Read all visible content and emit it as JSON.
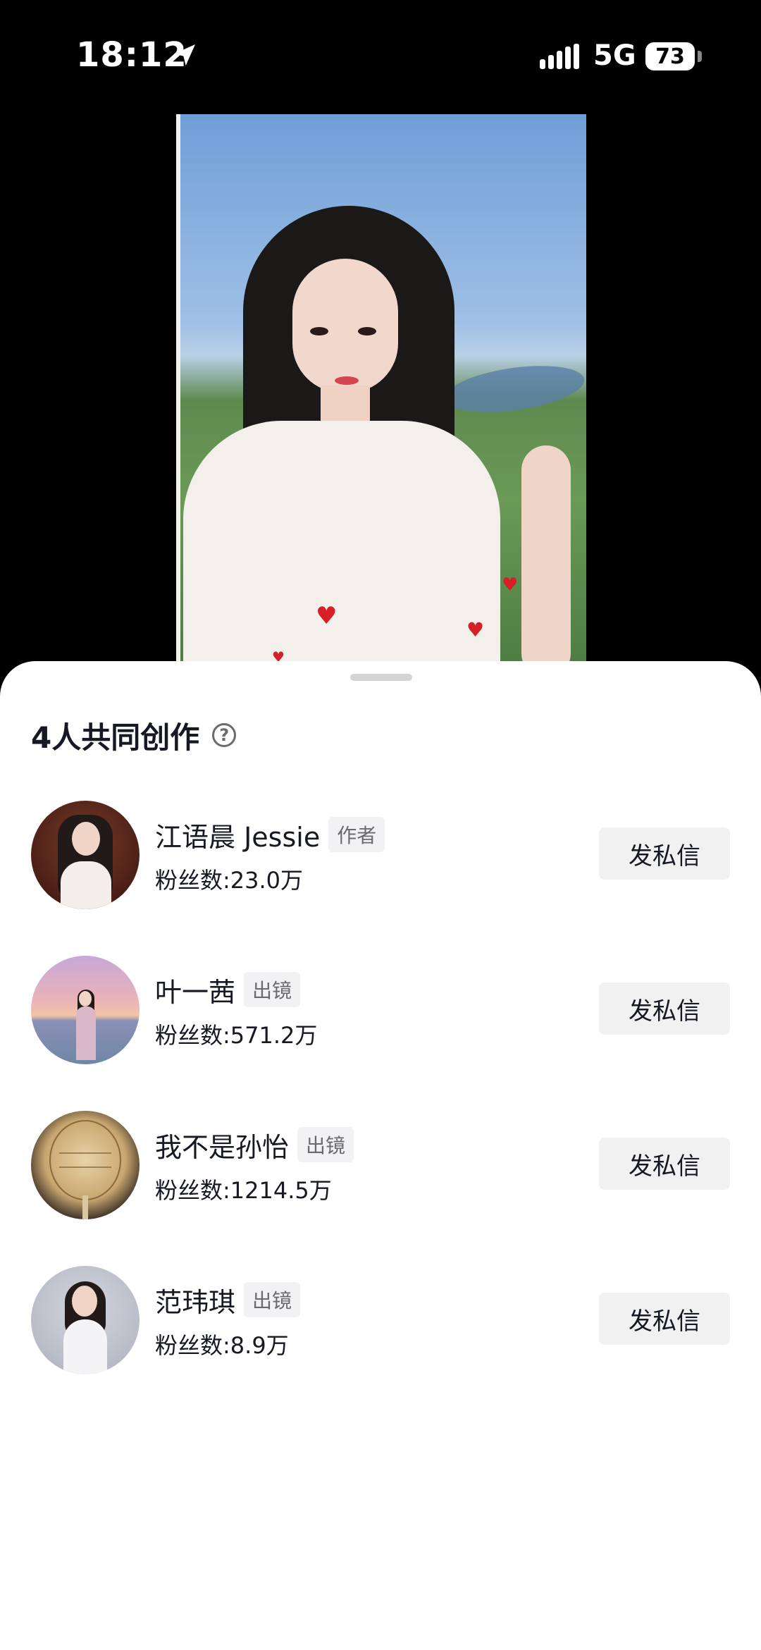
{
  "status_bar": {
    "time": "18:12",
    "network": "5G",
    "battery": "73"
  },
  "sheet": {
    "title": "4人共同创作",
    "help_icon": "question-circle-icon"
  },
  "creators": [
    {
      "name": "江语晨 Jessie",
      "role": "作者",
      "fans": "粉丝数:23.0万",
      "action": "发私信"
    },
    {
      "name": "叶一茜",
      "role": "出镜",
      "fans": "粉丝数:571.2万",
      "action": "发私信"
    },
    {
      "name": "我不是孙怡",
      "role": "出镜",
      "fans": "粉丝数:1214.5万",
      "action": "发私信"
    },
    {
      "name": "范玮琪",
      "role": "出镜",
      "fans": "粉丝数:8.9万",
      "action": "发私信"
    }
  ]
}
